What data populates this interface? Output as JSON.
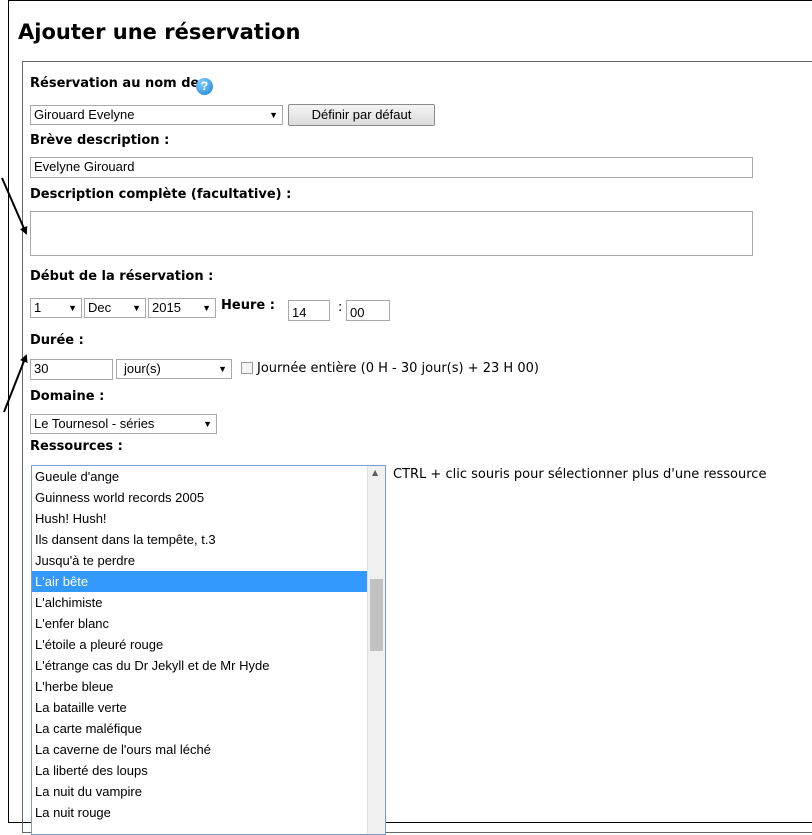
{
  "page_title": "Ajouter une réservation",
  "labels": {
    "reservation_for": "Réservation au nom de :",
    "brief_description": "Brève description :",
    "full_description": "Description complète (facultative) :",
    "start": "Début de la réservation :",
    "hour": "Heure :",
    "minute_sep": ":",
    "duration": "Durée :",
    "domain": "Domaine :",
    "resources": "Ressources :"
  },
  "reservation_for": {
    "selected": "Girouard Evelyne",
    "set_default_button": "Définir par défaut"
  },
  "brief_description_value": "Evelyne Girouard",
  "full_description_value": "",
  "start": {
    "day": "1",
    "month": "Dec",
    "year": "2015",
    "hour": "14",
    "minute": "00"
  },
  "duration": {
    "value": "30",
    "unit": "jour(s)",
    "all_day_checked": false,
    "all_day_label": "Journée entière (0 H - 30 jour(s) + 23 H 00)"
  },
  "domain_selected": "Le Tournesol - séries",
  "resources_hint": "CTRL + clic souris pour sélectionner plus d'une ressource",
  "resources": [
    {
      "label": "Gueule d'ange",
      "selected": false
    },
    {
      "label": "Guinness world records 2005",
      "selected": false
    },
    {
      "label": "Hush! Hush!",
      "selected": false
    },
    {
      "label": "Ils dansent dans la tempête, t.3",
      "selected": false
    },
    {
      "label": "Jusqu'à te perdre",
      "selected": false
    },
    {
      "label": "L'air bête",
      "selected": true
    },
    {
      "label": "L'alchimiste",
      "selected": false
    },
    {
      "label": "L'enfer blanc",
      "selected": false
    },
    {
      "label": "L'étoile a pleuré rouge",
      "selected": false
    },
    {
      "label": "L'étrange cas du Dr Jekyll et de Mr Hyde",
      "selected": false
    },
    {
      "label": "L'herbe bleue",
      "selected": false
    },
    {
      "label": "La bataille verte",
      "selected": false
    },
    {
      "label": "La carte maléfique",
      "selected": false
    },
    {
      "label": "La caverne de l'ours mal léché",
      "selected": false
    },
    {
      "label": "La liberté des loups",
      "selected": false
    },
    {
      "label": "La nuit du vampire",
      "selected": false
    },
    {
      "label": "La nuit rouge",
      "selected": false
    }
  ],
  "icons": {
    "help": "help-question-icon",
    "dropdown": "chevron-down-icon",
    "scroll_up": "scroll-up-arrow-icon"
  },
  "colors": {
    "selection": "#3399ff",
    "help_icon": "#1a7fd0"
  }
}
